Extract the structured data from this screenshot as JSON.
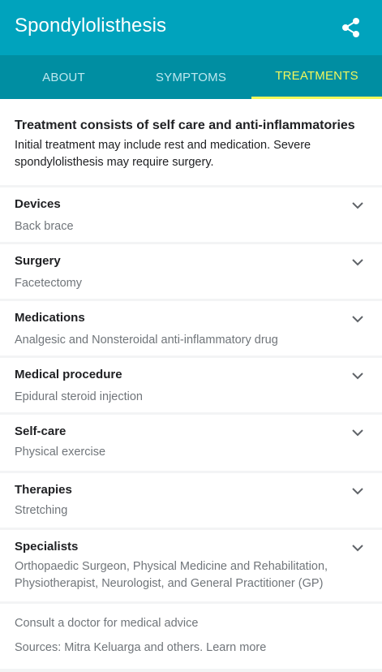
{
  "header": {
    "title": "Spondylolisthesis",
    "share_icon": "share-icon"
  },
  "tabs": [
    {
      "label": "ABOUT",
      "active": false
    },
    {
      "label": "SYMPTOMS",
      "active": false
    },
    {
      "label": "TREATMENTS",
      "active": true
    }
  ],
  "intro": {
    "heading": "Treatment consists of self care and anti-inflammatories",
    "body": "Initial treatment may include rest and medication. Severe spondylolisthesis may require surgery."
  },
  "rows": [
    {
      "label": "Devices",
      "value": "Back brace"
    },
    {
      "label": "Surgery",
      "value": "Facetectomy"
    },
    {
      "label": "Medications",
      "value": "Analgesic and Nonsteroidal anti-inflammatory drug"
    },
    {
      "label": "Medical procedure",
      "value": "Epidural steroid injection"
    },
    {
      "label": "Self-care",
      "value": "Physical exercise"
    },
    {
      "label": "Therapies",
      "value": "Stretching"
    },
    {
      "label": "Specialists",
      "value": "Orthopaedic Surgeon, Physical Medicine and Rehabilitation, Physiotherapist, Neurologist, and General Practitioner (GP)"
    }
  ],
  "footer": {
    "disclaimer": "Consult a doctor for medical advice",
    "sources": "Sources: Mitra Keluarga and others.",
    "learn_more": "Learn more"
  },
  "colors": {
    "header_bg": "#00a3bd",
    "tabs_bg": "#008ea2",
    "active_tab": "#f4f75b"
  }
}
